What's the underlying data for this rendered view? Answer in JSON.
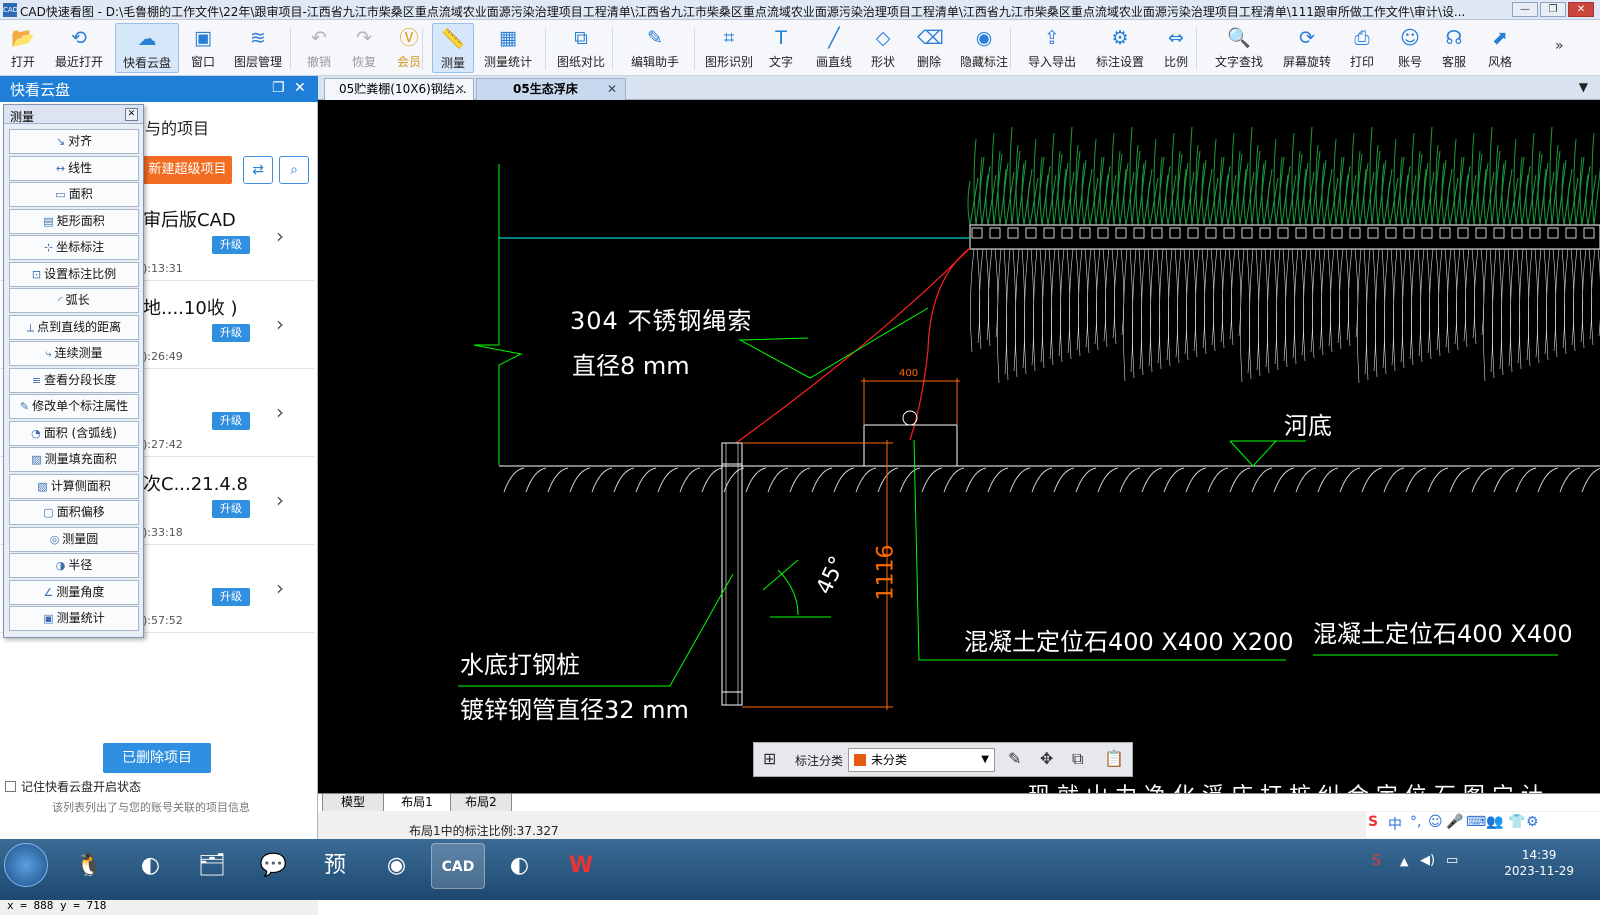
{
  "window": {
    "title": "CAD快速看图 - D:\\毛鲁棚的工作文件\\22年\\跟审项目-江西省九江市柴桑区重点流域农业面源污染治理项目工程清单\\江西省九江市柴桑区重点流域农业面源污染治理项目工程清单\\江西省九江市柴桑区重点流域农业面源污染治理项目工程清单\\111跟审所做工作文件\\审计\\设...",
    "app_icon": "CAD"
  },
  "toolbar": [
    {
      "label": "打开",
      "icon": "folder-open-icon",
      "glyph": "📂"
    },
    {
      "label": "最近打开",
      "icon": "history-icon",
      "glyph": "⟲"
    },
    {
      "label": "快看云盘",
      "icon": "cloud-icon",
      "glyph": "☁",
      "active": true
    },
    {
      "label": "窗口",
      "icon": "window-icon",
      "glyph": "▣"
    },
    {
      "label": "图层管理",
      "icon": "layers-icon",
      "glyph": "≋"
    },
    {
      "label": "撤销",
      "icon": "undo-icon",
      "glyph": "↶",
      "disabled": true
    },
    {
      "label": "恢复",
      "icon": "redo-icon",
      "glyph": "↷",
      "disabled": true
    },
    {
      "label": "会员",
      "icon": "vip-icon",
      "glyph": "Ⓥ",
      "vip": true
    },
    {
      "label": "测量",
      "icon": "measure-icon",
      "glyph": "📏",
      "active": true
    },
    {
      "label": "测量统计",
      "icon": "measure-stats-icon",
      "glyph": "▦"
    },
    {
      "label": "图纸对比",
      "icon": "compare-icon",
      "glyph": "⧉"
    },
    {
      "label": "编辑助手",
      "icon": "edit-assistant-icon",
      "glyph": "✎"
    },
    {
      "label": "图形识别",
      "icon": "shape-recognize-icon",
      "glyph": "⌗"
    },
    {
      "label": "文字",
      "icon": "text-icon",
      "glyph": "T"
    },
    {
      "label": "画直线",
      "icon": "line-icon",
      "glyph": "╱"
    },
    {
      "label": "形状",
      "icon": "shape-icon",
      "glyph": "◇"
    },
    {
      "label": "删除",
      "icon": "eraser-icon",
      "glyph": "⌫"
    },
    {
      "label": "隐藏标注",
      "icon": "hide-icon",
      "glyph": "◉"
    },
    {
      "label": "导入导出",
      "icon": "import-export-icon",
      "glyph": "⇪"
    },
    {
      "label": "标注设置",
      "icon": "annotation-settings-icon",
      "glyph": "⚙"
    },
    {
      "label": "比例",
      "icon": "scale-icon",
      "glyph": "⇔"
    },
    {
      "label": "文字查找",
      "icon": "text-search-icon",
      "glyph": "🔍"
    },
    {
      "label": "屏幕旋转",
      "icon": "rotate-icon",
      "glyph": "⟳"
    },
    {
      "label": "打印",
      "icon": "print-icon",
      "glyph": "⎙"
    },
    {
      "label": "账号",
      "icon": "account-icon",
      "glyph": "☺"
    },
    {
      "label": "客服",
      "icon": "headset-icon",
      "glyph": "☊"
    },
    {
      "label": "风格",
      "icon": "style-icon",
      "glyph": "⬈"
    }
  ],
  "toolbar_more": "»",
  "sidebar": {
    "title": "快看云盘",
    "subtitle": "与的项目",
    "new_project_button": "新建超级项目",
    "projects": [
      {
        "name": "审后版CAD",
        "upgrade": "升级",
        "time": "):13:31"
      },
      {
        "name": "地....10收 )",
        "upgrade": "升级",
        "time": "):26:49"
      },
      {
        "name": "",
        "upgrade": "升级",
        "time": "):27:42"
      },
      {
        "name": "次C...21.4.8",
        "upgrade": "升级",
        "time": "):33:18"
      },
      {
        "name": "",
        "upgrade": "升级",
        "time": "):57:52"
      }
    ],
    "deleted_button": "已删除项目",
    "remember_label": "记住快看云盘开启状态",
    "note": "该列表列出了与您的账号关联的项目信息"
  },
  "measure_panel": {
    "title": "测量",
    "items": [
      "对齐",
      "线性",
      "面积",
      "矩形面积",
      "坐标标注",
      "设置标注比例",
      "弧长",
      "点到直线的距离",
      "连续测量",
      "查看分段长度",
      "修改单个标注属性",
      "面积 (含弧线)",
      "测量填充面积",
      "计算侧面积",
      "面积偏移",
      "测量圆",
      "半径",
      "测量角度",
      "测量统计"
    ]
  },
  "doc_tabs": [
    {
      "label": "05贮粪棚(10X6)钢结…",
      "selected": false
    },
    {
      "label": "05生态浮床",
      "selected": true
    }
  ],
  "drawing": {
    "labels": {
      "rope_line1": "304 不锈钢绳索",
      "rope_line2": "直径8 mm",
      "dim_400": "400",
      "riverbed": "河底",
      "dim_1116": "1116",
      "angle": "45°",
      "pile_line1": "水底打钢桩",
      "pile_line2": "镀锌钢管直径32 mm",
      "stone1": "混凝土定位石400 X400 X200",
      "stone2": "混凝土定位石400 X400",
      "bottom_text": "现 就 山 力 净 化 浮 床 打 桩 纠 合 定 位 石 图 宁 计"
    },
    "colors": {
      "background": "#000000",
      "green": "#00ff00",
      "red": "#ff2020",
      "cyan": "#00ffff",
      "white": "#ffffff",
      "orange": "#ff6a00",
      "plants": "#1f9a3a"
    }
  },
  "float_toolbar": {
    "grid_icon": "grid-icon",
    "label": "标注分类",
    "select_value": "未分类",
    "swatch_color": "#e6590f"
  },
  "layout_tabs": [
    "模型",
    "布局1",
    "布局2"
  ],
  "status": {
    "coords": "x = 888  y = 718",
    "scale_text": "布局1中的标注比例:37.327"
  },
  "ime": [
    "S",
    "中",
    "°,",
    "☺",
    "🎤",
    "⌨",
    "👥",
    "👕",
    "⚙"
  ],
  "taskbar": {
    "apps": [
      {
        "name": "qq-icon",
        "glyph": "🐧"
      },
      {
        "name": "browser-icon",
        "glyph": "◐"
      },
      {
        "name": "explorer-icon",
        "glyph": "🗂"
      },
      {
        "name": "wechat-icon",
        "glyph": "💬"
      },
      {
        "name": "preview-icon",
        "glyph": "预"
      },
      {
        "name": "chrome-icon",
        "glyph": "◉"
      },
      {
        "name": "cad-icon",
        "glyph": "CAD",
        "active": true
      },
      {
        "name": "browser2-icon",
        "glyph": "◐"
      },
      {
        "name": "wps-icon",
        "glyph": "W"
      }
    ],
    "time": "14:39",
    "date": "2023-11-29"
  }
}
